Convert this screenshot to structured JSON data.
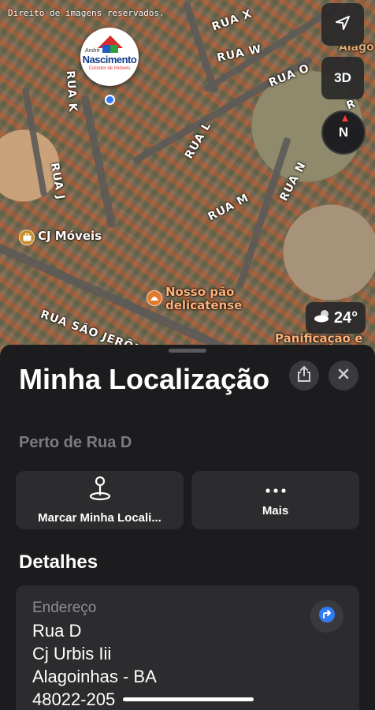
{
  "watermark": "Direito de imagens reservados.",
  "map": {
    "streets": {
      "rua_k": "RUA K",
      "rua_j": "RUA J",
      "rua_x": "RUA X",
      "rua_w": "RUA W",
      "rua_o": "RUA O",
      "rua_l": "RUA L",
      "rua_m": "RUA M",
      "rua_n": "RUA N",
      "rua_r": "R",
      "rua_sao_jeronimo": "RUA SÃO JERÔNIMO",
      "alago_top": "Alago"
    },
    "pin": {
      "small_text": "André",
      "name": "Nascimento",
      "subtitle": "Corretor de Imóveis"
    },
    "pois": {
      "cj_moveis": {
        "name": "CJ Móveis",
        "icon": "briefcase-icon"
      },
      "nosso_pao": {
        "line1": "Nosso pão",
        "line2": "delicatense",
        "icon": "bakery-icon"
      },
      "panificacao": {
        "name": "Panificação e"
      }
    },
    "controls": {
      "location_icon": "location-arrow-icon",
      "view_3d": "3D",
      "compass_letter": "N"
    },
    "weather": {
      "icon": "partly-cloudy-icon",
      "temperature": "24°"
    }
  },
  "sheet": {
    "title": "Minha Localização",
    "subtitle": "Perto de Rua D",
    "share_icon": "share-icon",
    "close_icon": "close-icon",
    "actions": [
      {
        "label": "Marcar Minha Locali...",
        "icon": "pin-marker-icon"
      },
      {
        "label": "Mais",
        "icon": "more-icon"
      }
    ],
    "details": {
      "heading": "Detalhes",
      "address_label": "Endereço",
      "address_lines": [
        "Rua D",
        "Cj Urbis Iii",
        "Alagoinhas - BA",
        "48022-205"
      ],
      "directions_icon": "directions-icon"
    }
  },
  "colors": {
    "sheet_bg": "#1c1c1e",
    "card_bg": "#2c2c2e",
    "accent_blue": "#2f7cf6",
    "poi_orange": "#ffb27a",
    "muted_text": "#8e8e93"
  }
}
